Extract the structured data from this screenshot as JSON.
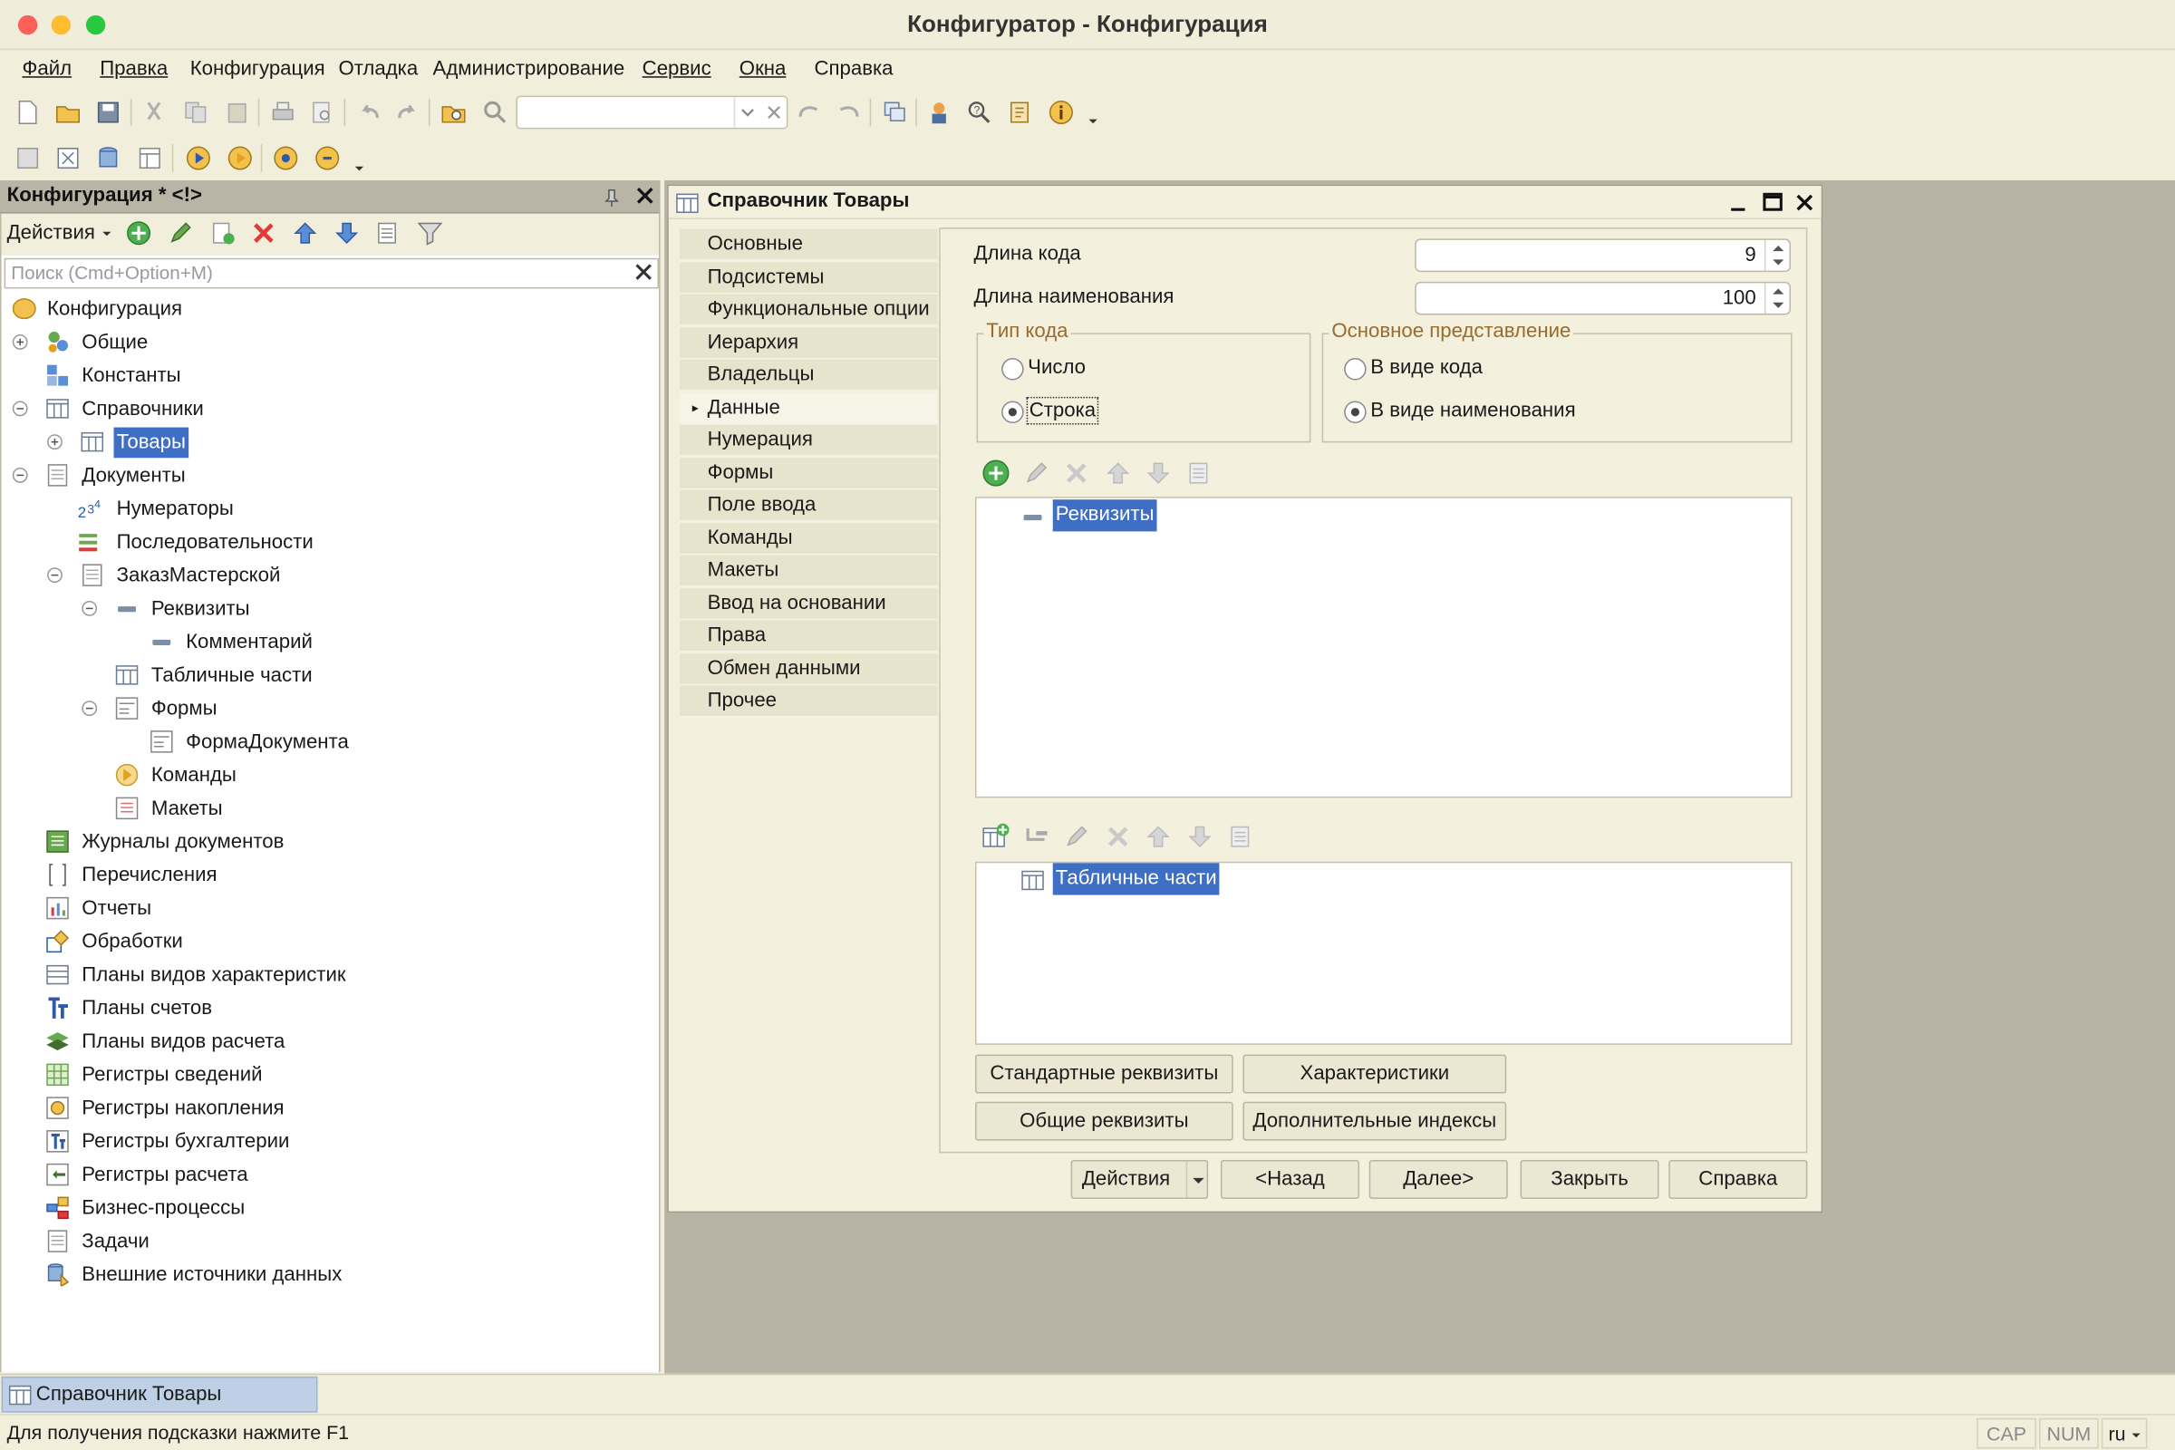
{
  "window": {
    "title": "Конфигуратор - Конфигурация"
  },
  "menu": [
    "Файл",
    "Правка",
    "Конфигурация",
    "Отладка",
    "Администрирование",
    "Сервис",
    "Окна",
    "Справка"
  ],
  "toolbar": {
    "search_value": ""
  },
  "left_panel": {
    "title": "Конфигурация * <!>",
    "actions_label": "Действия",
    "search_placeholder": "Поиск (Cmd+Option+M)",
    "tree": [
      "Конфигурация",
      "Общие",
      "Константы",
      "Справочники",
      "Товары",
      "Документы",
      "Нумераторы",
      "Последовательности",
      "ЗаказМастерской",
      "Реквизиты",
      "Комментарий",
      "Табличные части",
      "Формы",
      "ФормаДокумента",
      "Команды",
      "Макеты",
      "Журналы документов",
      "Перечисления",
      "Отчеты",
      "Обработки",
      "Планы видов характеристик",
      "Планы счетов",
      "Планы видов расчета",
      "Регистры сведений",
      "Регистры накопления",
      "Регистры бухгалтерии",
      "Регистры расчета",
      "Бизнес-процессы",
      "Задачи",
      "Внешние источники данных"
    ]
  },
  "dialog": {
    "title": "Справочник Товары",
    "nav": [
      "Основные",
      "Подсистемы",
      "Функциональные опции",
      "Иерархия",
      "Владельцы",
      "Данные",
      "Нумерация",
      "Формы",
      "Поле ввода",
      "Команды",
      "Макеты",
      "Ввод на основании",
      "Права",
      "Обмен данными",
      "Прочее"
    ],
    "active_nav": "Данные",
    "code_length_label": "Длина кода",
    "code_length": "9",
    "name_length_label": "Длина наименования",
    "name_length": "100",
    "code_type": {
      "label": "Тип кода",
      "options": [
        "Число",
        "Строка"
      ],
      "selected": "Строка"
    },
    "main_presentation": {
      "label": "Основное представление",
      "options": [
        "В виде кода",
        "В виде наименования"
      ],
      "selected": "В виде наименования"
    },
    "attributes_root": "Реквизиты",
    "tabular_root": "Табличные части",
    "buttons": {
      "standard_attrs": "Стандартные реквизиты",
      "characteristics": "Характеристики",
      "common_attrs": "Общие реквизиты",
      "extra_indexes": "Дополнительные индексы",
      "actions": "Действия",
      "back": "<Назад",
      "next": "Далее>",
      "close": "Закрыть",
      "help": "Справка"
    }
  },
  "taskbar": {
    "item": "Справочник Товары"
  },
  "status": {
    "hint": "Для получения подсказки нажмите F1",
    "cap": "CAP",
    "num": "NUM",
    "lang": "ru"
  }
}
